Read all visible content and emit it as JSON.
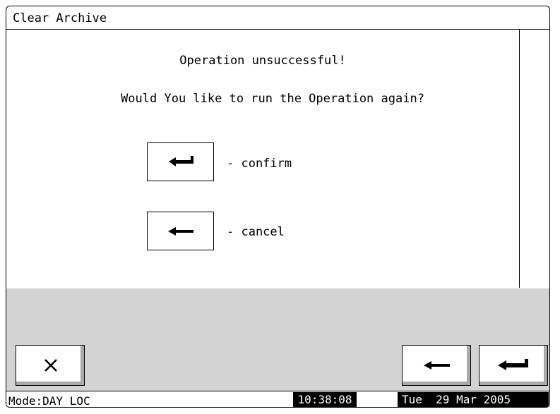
{
  "window": {
    "title": "Clear Archive"
  },
  "dialog": {
    "message": "Operation unsuccessful!",
    "question": "Would You like to run the Operation again?",
    "confirm": {
      "icon": "enter-arrow-icon",
      "label": "- confirm"
    },
    "cancel": {
      "icon": "back-arrow-icon",
      "label": "- cancel"
    }
  },
  "buttons": {
    "close": {
      "icon": "close-x-icon"
    },
    "back": {
      "icon": "back-arrow-icon"
    },
    "enter": {
      "icon": "enter-arrow-icon"
    }
  },
  "status": {
    "mode": "Mode:DAY LOC",
    "time": "10:38:08",
    "date": "Tue  29 Mar 2005"
  },
  "colors": {
    "panel": "#d3d3d3",
    "status_bg": "#000000",
    "status_fg": "#ffffff"
  }
}
